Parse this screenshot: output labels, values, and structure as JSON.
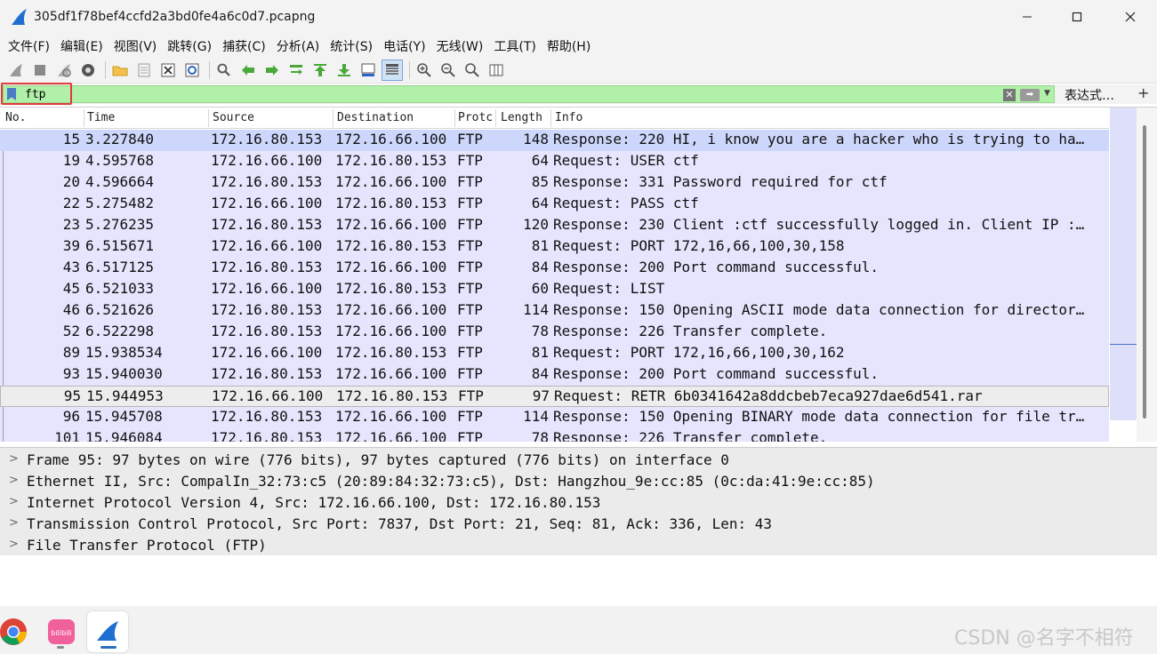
{
  "window": {
    "title": "305df1f78bef4ccfd2a3bd0fe4a6c0d7.pcapng"
  },
  "menu": [
    "文件(F)",
    "编辑(E)",
    "视图(V)",
    "跳转(G)",
    "捕获(C)",
    "分析(A)",
    "统计(S)",
    "电话(Y)",
    "无线(W)",
    "工具(T)",
    "帮助(H)"
  ],
  "toolbar": {
    "icons": [
      "shark-fin-start-icon",
      "stop-icon",
      "restart-icon",
      "options-gear-icon",
      "open-folder-icon",
      "file-icon",
      "close-file-icon",
      "reload-icon",
      "search-icon",
      "go-back-icon",
      "go-forward-icon",
      "go-to-packet-icon",
      "go-first-icon",
      "go-last-icon",
      "autoscroll-icon",
      "colorize-icon",
      "zoom-in-icon",
      "zoom-out-icon",
      "zoom-normal-icon",
      "resize-columns-icon"
    ]
  },
  "filter": {
    "value": "ftp",
    "expression_label": "表达式…",
    "add_label": "+"
  },
  "columns": {
    "no": "No.",
    "time": "Time",
    "source": "Source",
    "destination": "Destination",
    "protocol": "Protc",
    "length": "Length",
    "info": "Info"
  },
  "packets": [
    {
      "no": "15",
      "time": "3.227840",
      "src": "172.16.80.153",
      "dst": "172.16.66.100",
      "proto": "FTP",
      "len": "148",
      "info": "Response: 220 HI, i know you are a hacker who is trying to ha…"
    },
    {
      "no": "19",
      "time": "4.595768",
      "src": "172.16.66.100",
      "dst": "172.16.80.153",
      "proto": "FTP",
      "len": "64",
      "info": "Request: USER ctf"
    },
    {
      "no": "20",
      "time": "4.596664",
      "src": "172.16.80.153",
      "dst": "172.16.66.100",
      "proto": "FTP",
      "len": "85",
      "info": "Response: 331 Password required for ctf"
    },
    {
      "no": "22",
      "time": "5.275482",
      "src": "172.16.66.100",
      "dst": "172.16.80.153",
      "proto": "FTP",
      "len": "64",
      "info": "Request: PASS ctf"
    },
    {
      "no": "23",
      "time": "5.276235",
      "src": "172.16.80.153",
      "dst": "172.16.66.100",
      "proto": "FTP",
      "len": "120",
      "info": "Response: 230 Client :ctf successfully logged in. Client IP :…"
    },
    {
      "no": "39",
      "time": "6.515671",
      "src": "172.16.66.100",
      "dst": "172.16.80.153",
      "proto": "FTP",
      "len": "81",
      "info": "Request: PORT 172,16,66,100,30,158"
    },
    {
      "no": "43",
      "time": "6.517125",
      "src": "172.16.80.153",
      "dst": "172.16.66.100",
      "proto": "FTP",
      "len": "84",
      "info": "Response: 200 Port command successful."
    },
    {
      "no": "45",
      "time": "6.521033",
      "src": "172.16.66.100",
      "dst": "172.16.80.153",
      "proto": "FTP",
      "len": "60",
      "info": "Request: LIST"
    },
    {
      "no": "46",
      "time": "6.521626",
      "src": "172.16.80.153",
      "dst": "172.16.66.100",
      "proto": "FTP",
      "len": "114",
      "info": "Response: 150 Opening ASCII mode data connection for director…"
    },
    {
      "no": "52",
      "time": "6.522298",
      "src": "172.16.80.153",
      "dst": "172.16.66.100",
      "proto": "FTP",
      "len": "78",
      "info": "Response: 226 Transfer complete."
    },
    {
      "no": "89",
      "time": "15.938534",
      "src": "172.16.66.100",
      "dst": "172.16.80.153",
      "proto": "FTP",
      "len": "81",
      "info": "Request: PORT 172,16,66,100,30,162"
    },
    {
      "no": "93",
      "time": "15.940030",
      "src": "172.16.80.153",
      "dst": "172.16.66.100",
      "proto": "FTP",
      "len": "84",
      "info": "Response: 200 Port command successful."
    },
    {
      "no": "95",
      "time": "15.944953",
      "src": "172.16.66.100",
      "dst": "172.16.80.153",
      "proto": "FTP",
      "len": "97",
      "info": "Request: RETR 6b0341642a8ddcbeb7eca927dae6d541.rar"
    },
    {
      "no": "96",
      "time": "15.945708",
      "src": "172.16.80.153",
      "dst": "172.16.66.100",
      "proto": "FTP",
      "len": "114",
      "info": "Response: 150 Opening BINARY mode data connection for file tr…"
    },
    {
      "no": "101",
      "time": "15.946084",
      "src": "172.16.80.153",
      "dst": "172.16.66.100",
      "proto": "FTP",
      "len": "78",
      "info": "Response: 226 Transfer complete."
    }
  ],
  "selected_packet": "95",
  "details": [
    "Frame 95: 97 bytes on wire (776 bits), 97 bytes captured (776 bits) on interface 0",
    "Ethernet II, Src: CompalIn_32:73:c5 (20:89:84:32:73:c5), Dst: Hangzhou_9e:cc:85 (0c:da:41:9e:cc:85)",
    "Internet Protocol Version 4, Src: 172.16.66.100, Dst: 172.16.80.153",
    "Transmission Control Protocol, Src Port: 7837, Dst Port: 21, Seq: 81, Ack: 336, Len: 43",
    "File Transfer Protocol (FTP)"
  ],
  "taskbar": [
    "chrome-icon",
    "bilibili-icon",
    "wireshark-icon"
  ],
  "watermark": "CSDN @名字不相符",
  "colors": {
    "row_bg": "#e5e5fe",
    "filter_valid": "#b0f0a8",
    "highlight_box": "#e03b3b"
  }
}
